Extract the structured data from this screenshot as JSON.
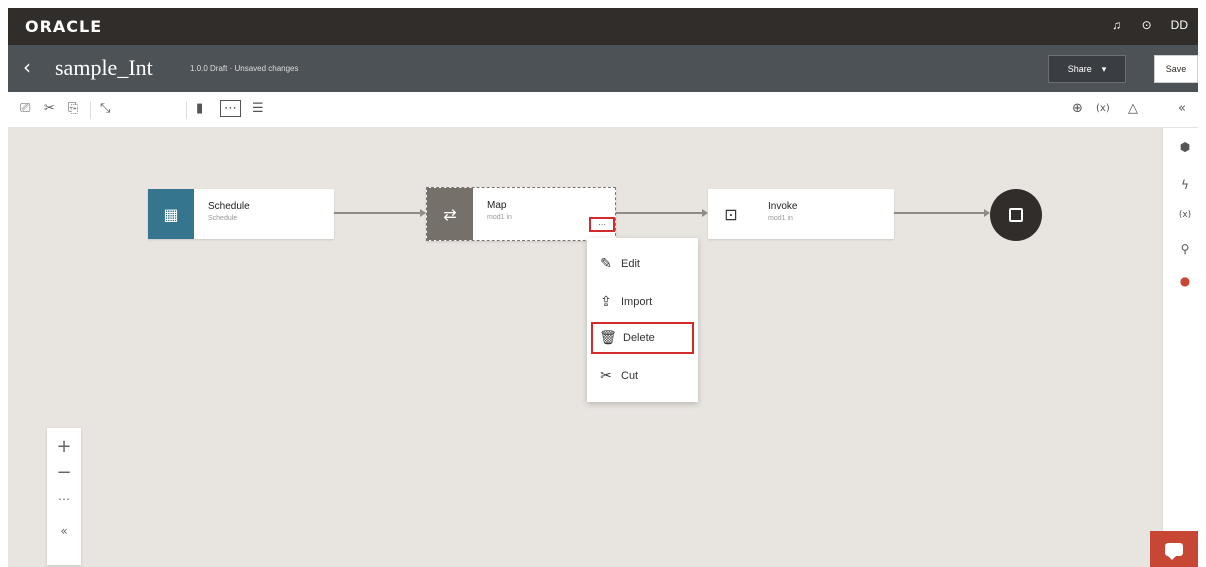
{
  "brand": "ORACLE",
  "top_icons": [
    {
      "name": "notifications-icon",
      "glyph": "♫"
    },
    {
      "name": "help-icon",
      "glyph": "⊙"
    },
    {
      "name": "user-avatar",
      "glyph": "DD"
    }
  ],
  "header": {
    "back_glyph": "‹",
    "title": "sample_Int",
    "subtitle": "1.0.0 Draft · Unsaved changes",
    "share_label": "Share",
    "share_chevron": "▾",
    "save_label": "Save"
  },
  "toolbar": {
    "tools": [
      {
        "name": "save-icon",
        "glyph": "⎚"
      },
      {
        "name": "cut-icon",
        "glyph": "✂"
      },
      {
        "name": "paste-icon",
        "glyph": "⎘"
      },
      {
        "name": "collapse-icon",
        "glyph": "⤡"
      },
      {
        "name": "vertical-layout-icon",
        "glyph": "▮"
      },
      {
        "name": "horizontal-layout-icon",
        "glyph": "⋯"
      },
      {
        "name": "pseudo-view-icon",
        "glyph": "☰"
      }
    ],
    "right_tools": [
      {
        "name": "globe-icon",
        "glyph": "⊕"
      },
      {
        "name": "variables-icon",
        "glyph": "(x)"
      },
      {
        "name": "warning-icon",
        "glyph": "△"
      }
    ],
    "collapse_glyph": "«"
  },
  "right_rail": [
    {
      "name": "settings-icon",
      "glyph": "⬢"
    },
    {
      "name": "lightning-icon",
      "glyph": "ϟ"
    },
    {
      "name": "variables-rail-icon",
      "glyph": "(x)"
    },
    {
      "name": "search-icon",
      "glyph": "⚲"
    },
    {
      "name": "integrations-icon",
      "glyph": "●"
    }
  ],
  "nodes": {
    "schedule": {
      "name": "Schedule",
      "sub": "Schedule",
      "icon_color": "#36758e",
      "glyph": "▦"
    },
    "map": {
      "name": "Map",
      "sub": "mod1 in",
      "icon_color": "#76706b",
      "glyph": "⇄"
    },
    "invoke": {
      "name": "Invoke",
      "sub": "mod1 in",
      "icon_color": "#ffffff",
      "glyph": "⊡"
    }
  },
  "more_glyph": "⋯",
  "context_menu": [
    {
      "label": "Edit",
      "glyph": "✎"
    },
    {
      "label": "Import",
      "glyph": "⇪"
    },
    {
      "label": "Delete",
      "glyph": "🗑"
    },
    {
      "label": "Cut",
      "glyph": "✂"
    }
  ],
  "zoom": {
    "in": "+",
    "out": "−",
    "fit": "⋯",
    "collapse": "«"
  },
  "colors": {
    "accent": "#36758e",
    "highlight": "#d52a2a",
    "chat": "#c74634"
  }
}
